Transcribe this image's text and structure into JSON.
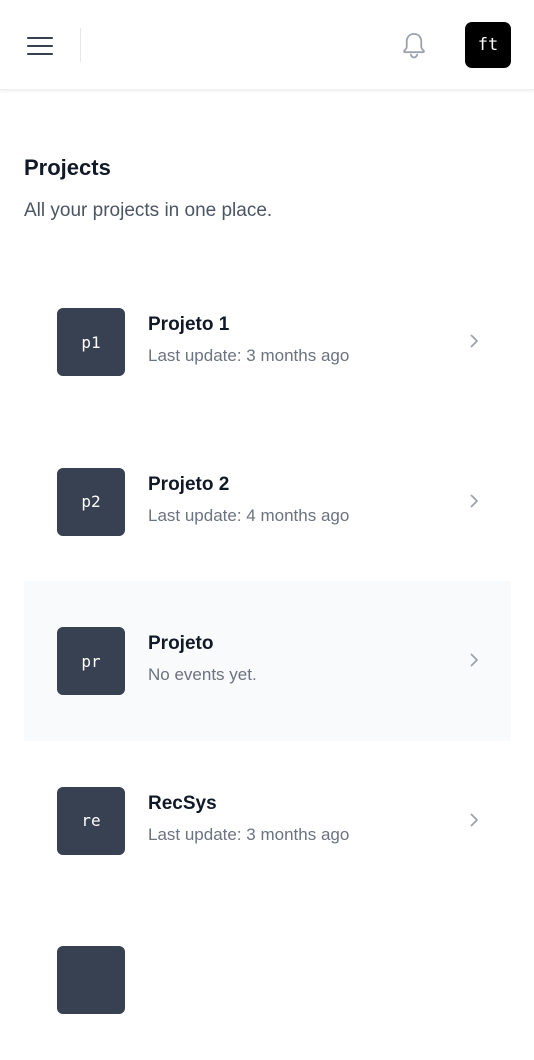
{
  "header": {
    "menu_icon": "hamburger-menu-icon",
    "bell_icon": "bell-icon",
    "avatar_initials": "ft"
  },
  "page": {
    "title": "Projects",
    "subtitle": "All your projects in one place."
  },
  "projects": [
    {
      "initials": "p1",
      "name": "Projeto 1",
      "meta": "Last update: 3 months ago",
      "highlighted": false
    },
    {
      "initials": "p2",
      "name": "Projeto 2",
      "meta": "Last update: 4 months ago",
      "highlighted": false
    },
    {
      "initials": "pr",
      "name": "Projeto",
      "meta": "No events yet.",
      "highlighted": true
    },
    {
      "initials": "re",
      "name": "RecSys",
      "meta": "Last update: 3 months ago",
      "highlighted": false
    },
    {
      "initials": "",
      "name": "",
      "meta": "",
      "highlighted": false
    }
  ],
  "colors": {
    "tile_bg": "#374151",
    "avatar_bg": "#000000",
    "highlight_bg": "#f9fafb",
    "muted_text": "#6b7280"
  }
}
